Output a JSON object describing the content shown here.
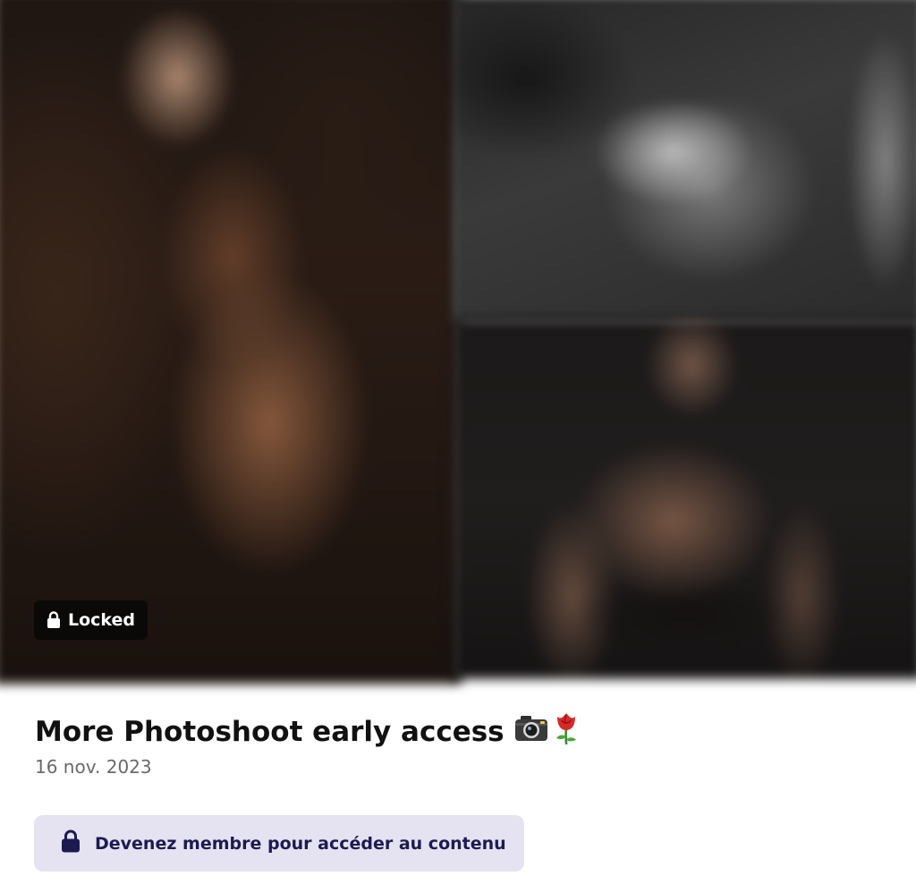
{
  "post": {
    "locked_label": "Locked",
    "title": "More Photoshoot early access",
    "title_icons": [
      "camera-icon",
      "rose-icon"
    ],
    "date": "16 nov. 2023",
    "cta_label": "Devenez membre pour accéder au contenu"
  },
  "colors": {
    "cta_background": "#e5e2f1",
    "cta_text": "#1d1a52",
    "badge_background": "#080808"
  }
}
